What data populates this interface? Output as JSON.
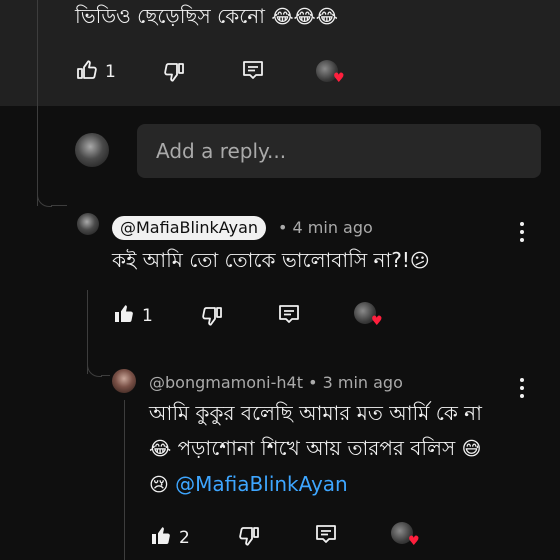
{
  "comment_top": {
    "text": "ভিডিও ছেড়েছিস কেনো",
    "emoji": "😂😂😂",
    "like_count": "1"
  },
  "reply_box": {
    "placeholder": "Add a reply..."
  },
  "reply1": {
    "author": "@MafiaBlinkAyan",
    "time": "• 4 min ago",
    "text": "কই আমি তো তোকে ভালোবাসি না?!",
    "emoji": "😕",
    "like_count": "1"
  },
  "reply2": {
    "author": "@bongmamoni-h4t",
    "time": "• 3 min ago",
    "line1": "আমি কুকুর বলেছি আমার মত আর্মি কে না",
    "line2_emoji_start": "😂",
    "line2": "পড়াশোনা শিখে আয় তারপর বলিস",
    "line2_emoji_end": "😅",
    "line3_emoji": "😢",
    "mention": "@MafiaBlinkAyan",
    "like_count": "2"
  },
  "colors": {
    "background": "#0f0f0f",
    "panel": "#212121",
    "input": "#272727",
    "text": "#f1f1f1",
    "muted": "#aaaaaa",
    "link": "#3ea6ff",
    "heart": "#ff1f3d"
  },
  "icons": [
    "thumb-up-icon",
    "thumb-down-icon",
    "reply-icon",
    "heart-icon",
    "more-vert-icon"
  ]
}
